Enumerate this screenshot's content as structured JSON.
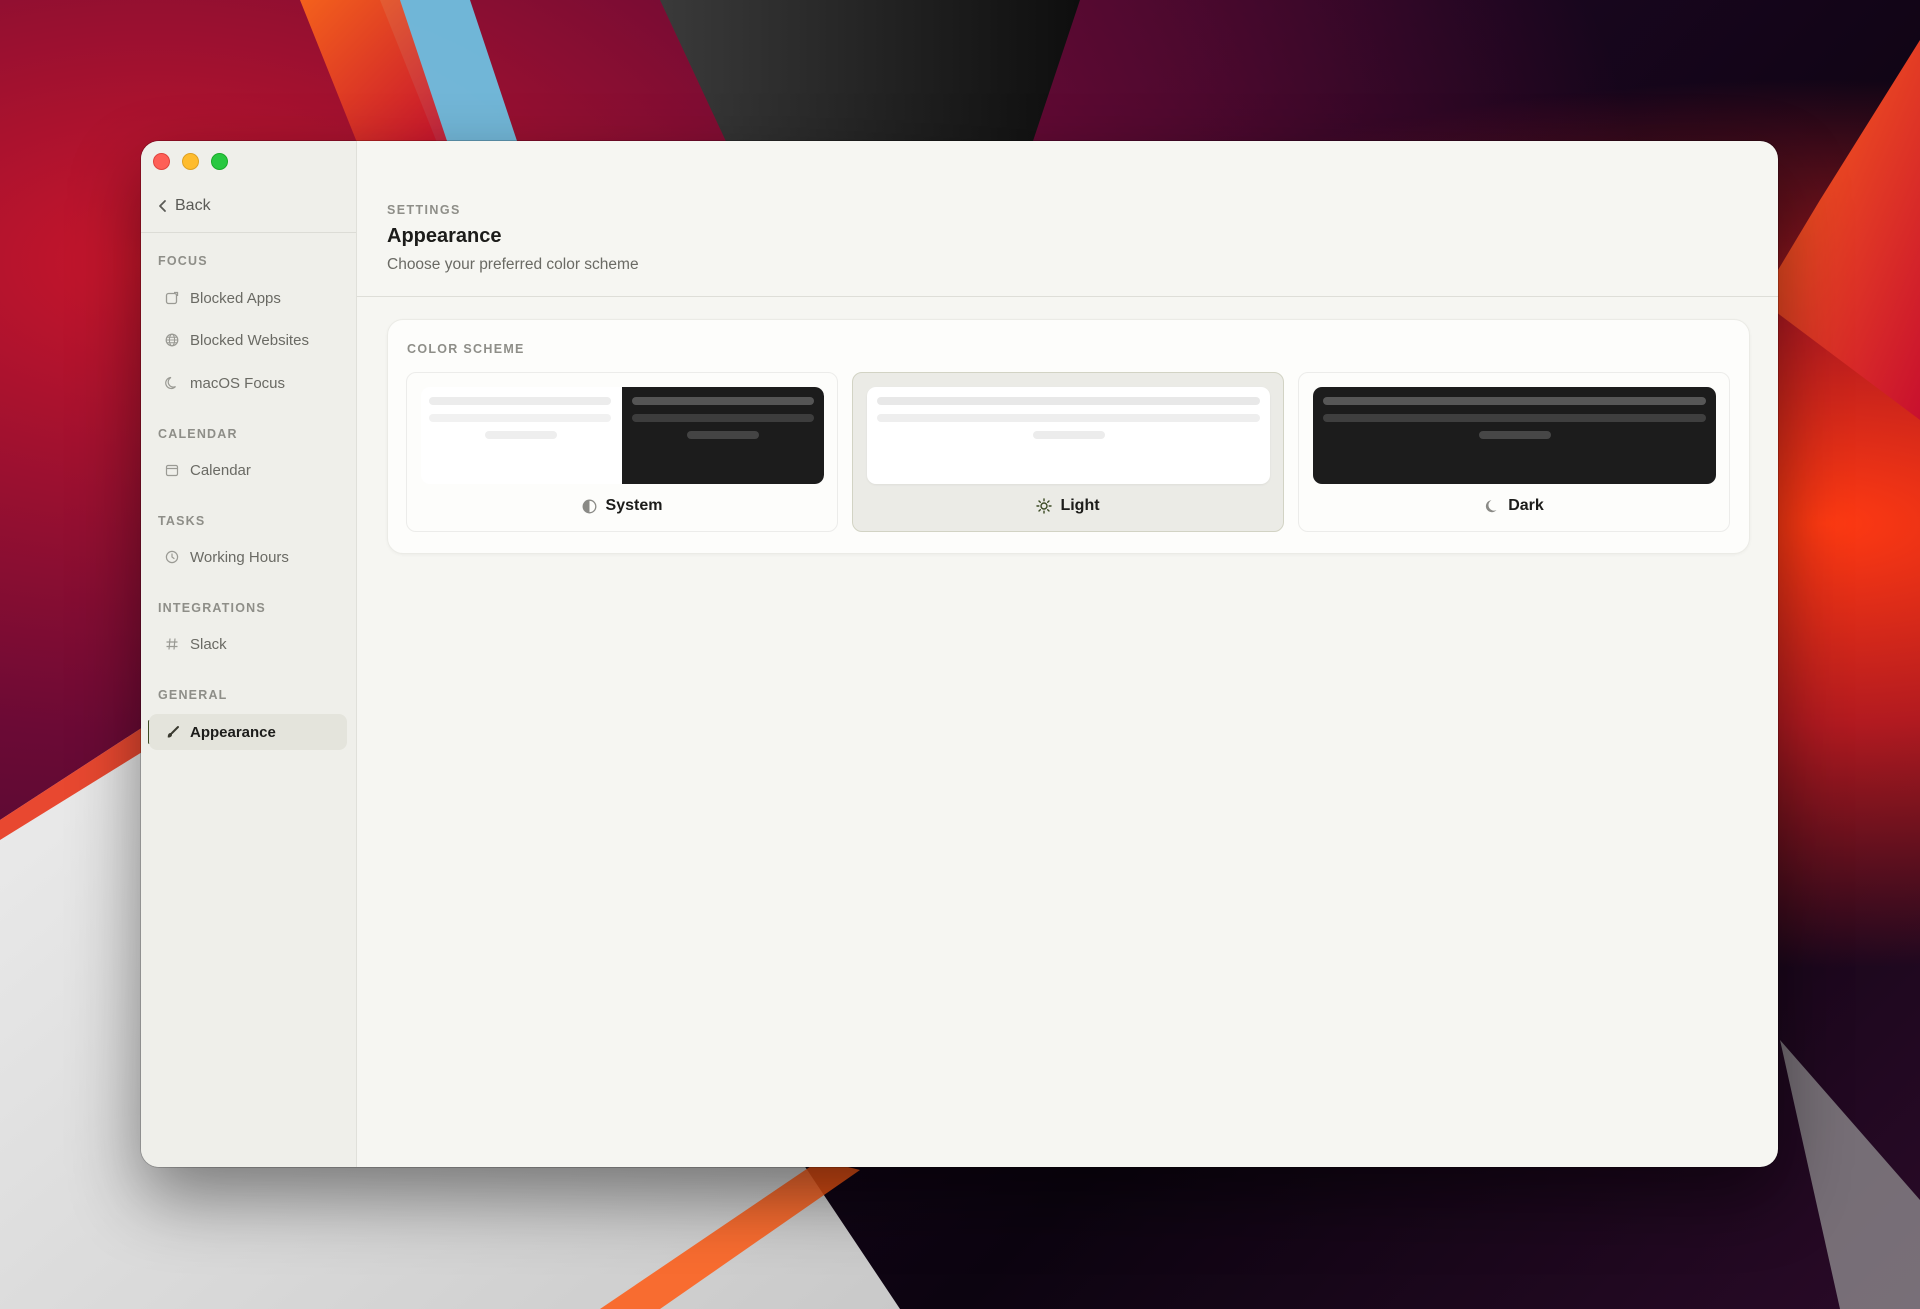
{
  "window": {
    "back_label": "Back"
  },
  "sidebar": {
    "sections": [
      {
        "label": "FOCUS"
      },
      {
        "label": "CALENDAR"
      },
      {
        "label": "TASKS"
      },
      {
        "label": "INTEGRATIONS"
      },
      {
        "label": "GENERAL"
      }
    ],
    "items": [
      {
        "label": "Blocked Apps",
        "icon": "app-icon"
      },
      {
        "label": "Blocked Websites",
        "icon": "globe-icon"
      },
      {
        "label": "macOS Focus",
        "icon": "moon-icon"
      },
      {
        "label": "Calendar",
        "icon": "calendar-icon"
      },
      {
        "label": "Working Hours",
        "icon": "clock-icon"
      },
      {
        "label": "Slack",
        "icon": "hash-icon"
      },
      {
        "label": "Appearance",
        "icon": "paintbrush-icon",
        "active": true
      }
    ]
  },
  "main": {
    "breadcrumb": "SETTINGS",
    "title": "Appearance",
    "subtitle": "Choose your preferred color scheme"
  },
  "color_scheme": {
    "label": "COLOR SCHEME",
    "selected": "Light",
    "options": [
      {
        "label": "System",
        "icon": "half-circle-icon"
      },
      {
        "label": "Light",
        "icon": "sun-icon"
      },
      {
        "label": "Dark",
        "icon": "moon-icon"
      }
    ]
  },
  "colors": {
    "accent": "#3b4a23",
    "window_bg": "#f6f6f2",
    "sidebar_bg": "#efefea"
  }
}
